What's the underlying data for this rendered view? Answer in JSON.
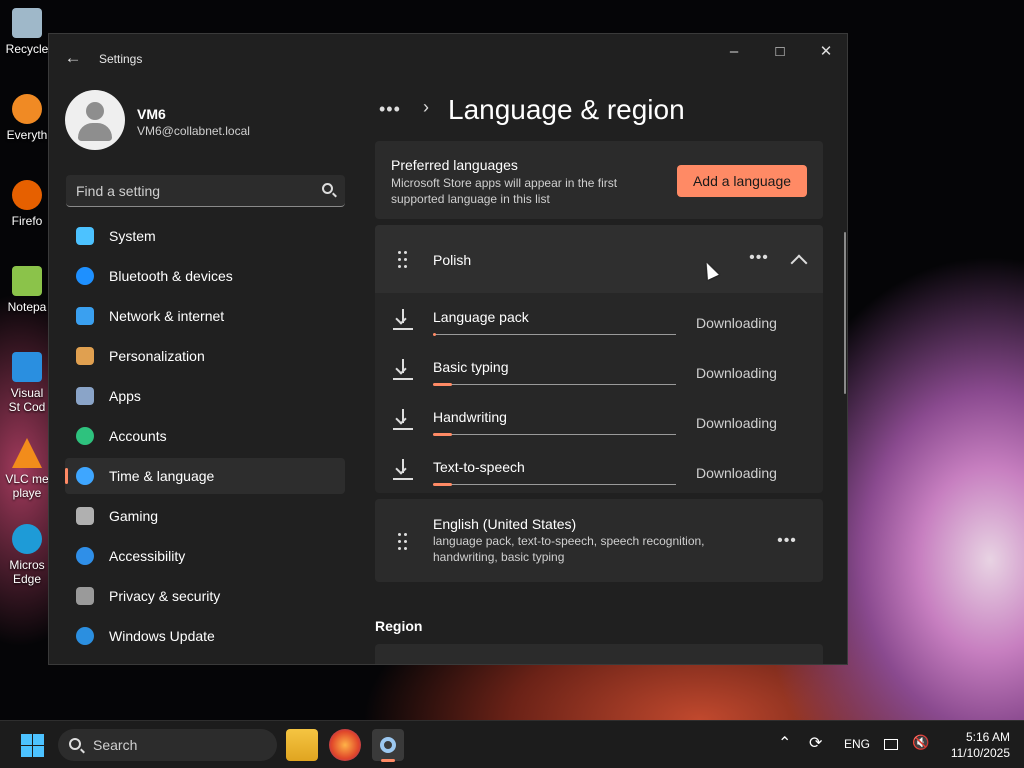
{
  "desktop": {
    "icons": [
      {
        "label": "Recycle",
        "color": "#9fb8c9"
      },
      {
        "label": "Everyth",
        "color": "#f08a24"
      },
      {
        "label": "Firefo",
        "color": "#e66000"
      },
      {
        "label": "Notepa",
        "color": "#8bc34a"
      },
      {
        "label": "Visual St Cod",
        "color": "#2a8fe0"
      },
      {
        "label": "VLC me playe",
        "color": "#f28c1b"
      },
      {
        "label": "Micros Edge",
        "color": "#1e9bd7"
      }
    ]
  },
  "window": {
    "title": "Settings",
    "controls": {
      "minimize": "–",
      "maximize": "□",
      "close": "✕"
    }
  },
  "profile": {
    "name": "VM6",
    "email": "VM6@collabnet.local"
  },
  "search": {
    "placeholder": "Find a setting"
  },
  "nav": {
    "items": [
      {
        "label": "System",
        "icon": "monitor-icon",
        "color": "#4cc2ff"
      },
      {
        "label": "Bluetooth & devices",
        "icon": "bluetooth-icon",
        "color": "#1e90ff"
      },
      {
        "label": "Network & internet",
        "icon": "wifi-icon",
        "color": "#3aa0f0"
      },
      {
        "label": "Personalization",
        "icon": "brush-icon",
        "color": "#e0a050"
      },
      {
        "label": "Apps",
        "icon": "apps-icon",
        "color": "#8aa4c8"
      },
      {
        "label": "Accounts",
        "icon": "person-icon",
        "color": "#2ec27e"
      },
      {
        "label": "Time & language",
        "icon": "globe-clock-icon",
        "color": "#3ea6ff"
      },
      {
        "label": "Gaming",
        "icon": "gamepad-icon",
        "color": "#b0b0b0"
      },
      {
        "label": "Accessibility",
        "icon": "accessibility-icon",
        "color": "#2f8fe8"
      },
      {
        "label": "Privacy & security",
        "icon": "shield-icon",
        "color": "#9a9a9a"
      },
      {
        "label": "Windows Update",
        "icon": "update-icon",
        "color": "#2b8fe0"
      }
    ],
    "active_index": 6
  },
  "page": {
    "breadcrumb_ellipsis": "•••",
    "breadcrumb_sep": "›",
    "title": "Language & region"
  },
  "preferred": {
    "title": "Preferred languages",
    "description": "Microsoft Store apps will appear in the first supported language in this list",
    "add_button": "Add a language"
  },
  "polish": {
    "name": "Polish",
    "more": "•••",
    "downloads": [
      {
        "name": "Language pack",
        "status": "Downloading",
        "progress": 0.01
      },
      {
        "name": "Basic typing",
        "status": "Downloading",
        "progress": 0.08
      },
      {
        "name": "Handwriting",
        "status": "Downloading",
        "progress": 0.08
      },
      {
        "name": "Text-to-speech",
        "status": "Downloading",
        "progress": 0.08
      }
    ]
  },
  "english": {
    "name": "English (United States)",
    "description": "language pack, text-to-speech, speech recognition, handwriting, basic typing",
    "more": "•••"
  },
  "region": {
    "heading": "Region"
  },
  "taskbar": {
    "search_label": "Search",
    "lang": "ENG",
    "time": "5:16 AM",
    "date": "11/10/2025"
  },
  "accent_color": "#ff8a65"
}
